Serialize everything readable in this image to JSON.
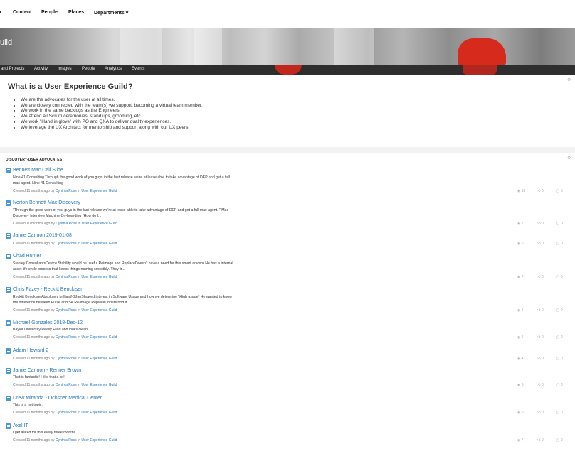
{
  "topnav": {
    "items": [
      "Content",
      "People",
      "Places",
      "Departments ▾"
    ]
  },
  "banner": {
    "title": "uild"
  },
  "subnav": {
    "items": [
      "and Projects",
      "Activity",
      "Images",
      "People",
      "Analytics",
      "Events"
    ]
  },
  "about": {
    "title": "What is a User Experience Guild?",
    "bullets": [
      "We are the advocates for the user at all times.",
      "We are closely connected with the team(s) we support, becoming a virtual team member.",
      "We work in the same backlogs as the Engineers.",
      "We attend all Scrum ceremonies, stand ups, grooming, etc.",
      "We work \"Hand in glove\" with PO and QXA to deliver quality experiences.",
      "We leverage the UX Architect for mentorship and support along with our UX peers."
    ]
  },
  "discovery": {
    "heading": "DISCOVERY-USER ADVOCATES",
    "entries": [
      {
        "title": "Bennett Mac Call Slide",
        "excerpt": "Nine 41 Consulting Through the good work of you guys in the last release we're at lease able to take advantage of DEP and get a full mac agent. Nine 41 Consulting",
        "created": "Created 11 months ago by",
        "author": "Cynthia Ross",
        "in": "in",
        "place": "User Experience Guild",
        "views": "13",
        "likes": "0",
        "comments": "0"
      },
      {
        "title": "Norton Bennett Mac Discovery",
        "excerpt": "\"Through the good work of you guys in the last release we're at lease able to take advantage of DEP and get a full mac agent. \" Mac Discovery Interview Machine On-boarding \"How do I...",
        "created": "Created 10 months ago by",
        "author": "Cynthia Ross",
        "in": "in",
        "place": "User Experience Guild",
        "views": "2",
        "likes": "0",
        "comments": "0"
      },
      {
        "title": "Jamie Cannon  2019-01-08",
        "excerpt": "",
        "created": "Created 11 months ago by",
        "author": "Cynthia Ross",
        "in": "in",
        "place": "User Experience Guild",
        "views": "6",
        "likes": "0",
        "comments": "0"
      },
      {
        "title": "Chad Hunter",
        "excerpt": "Stanley ConsultantsDevice Stability would be useful.Reimage and ReplaceDoesn't have a need for this smart advisor He has a internal asset life cycle process that keeps things running smoothly. They tr...",
        "created": "Created 11 months ago by",
        "author": "Cynthia Ross",
        "in": "in",
        "place": "User Experience Guild",
        "views": "7",
        "likes": "0",
        "comments": "0"
      },
      {
        "title": "Chris Fazey - Reckitt Benckiser",
        "excerpt": "Reckitt BenckiserAbsolutely brilliant!OtherShowed interest in Software Usage and how we determine \"High usage\" He wanted to know the difference between Pulse and SA Re-image ReplaceUnderstood it...",
        "created": "Created 11 months ago by",
        "author": "Cynthia Ross",
        "in": "in",
        "place": "User Experience Guild",
        "views": "6",
        "likes": "0",
        "comments": "0"
      },
      {
        "title": "Michael Gonzales 2018-Dec-12",
        "excerpt": "Baylor University Really Fluid and looks clean.",
        "created": "Created 11 months ago by",
        "author": "Cynthia Ross",
        "in": "in",
        "place": "User Experience Guild",
        "views": "6",
        "likes": "0",
        "comments": "0"
      },
      {
        "title": "Adam Howard 2",
        "excerpt": "",
        "created": "Created 11 months ago by",
        "author": "Cynthia Ross",
        "in": "in",
        "place": "User Experience Guild",
        "views": "4",
        "likes": "0",
        "comments": "0"
      },
      {
        "title": "Jamie Cannon - Renner Brown",
        "excerpt": "That is fantastic! I like that a lot!!",
        "created": "Created 11 months ago by",
        "author": "Cynthia Ross",
        "in": "in",
        "place": "User Experience Guild",
        "views": "6",
        "likes": "0",
        "comments": "0"
      },
      {
        "title": "Drew Miranda - Ochsner Medical Center",
        "excerpt": "This is a hot topic.",
        "created": "Created 11 months ago by",
        "author": "Cynthia Ross",
        "in": "in",
        "place": "User Experience Guild",
        "views": "6",
        "likes": "0",
        "comments": "0"
      },
      {
        "title": "Axel IT",
        "excerpt": "I get asked for this every three months.",
        "created": "Created 11 months ago by",
        "author": "Cynthia Ross",
        "in": "in",
        "place": "User Experience Guild",
        "views": "7",
        "likes": "0",
        "comments": "0"
      }
    ]
  },
  "icons": {
    "settings": "gear-icon",
    "document": "document-icon",
    "views": "eye-icon",
    "likes": "thumbs-up-icon",
    "comments": "comment-icon"
  },
  "colors": {
    "link": "#2a7ab8",
    "subnav_bg": "#2e2e2e",
    "accent_red": "#d62a1d"
  }
}
